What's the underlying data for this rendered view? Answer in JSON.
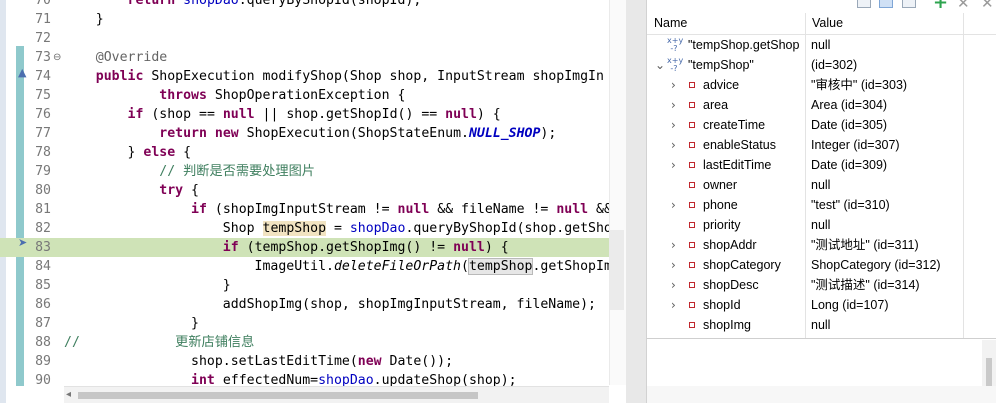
{
  "editor": {
    "lines": [
      {
        "num": "70",
        "html": "        <span class=\"kw\">return</span> <span class=\"fld\">shopDao</span>.queryByShopId(shopId);",
        "hl": false
      },
      {
        "num": "71",
        "html": "    }",
        "hl": false
      },
      {
        "num": "72",
        "html": "",
        "hl": false
      },
      {
        "num": "73",
        "html": "    <span class=\"ann\">@Override</span>",
        "hl": false,
        "fold": "⊖"
      },
      {
        "num": "74",
        "html": "    <span class=\"kw\">public</span> ShopExecution modifyShop(Shop shop, InputStream shopImgIn",
        "hl": false
      },
      {
        "num": "75",
        "html": "            <span class=\"kw\">throws</span> ShopOperationException {",
        "hl": false
      },
      {
        "num": "76",
        "html": "        <span class=\"kw\">if</span> (shop == <span class=\"kw\">null</span> || shop.getShopId() == <span class=\"kw\">null</span>) {",
        "hl": false
      },
      {
        "num": "77",
        "html": "            <span class=\"kw\">return</span> <span class=\"kw\">new</span> ShopExecution(ShopStateEnum.<span class=\"const\">NULL_SHOP</span>);",
        "hl": false
      },
      {
        "num": "78",
        "html": "        } <span class=\"kw\">else</span> {",
        "hl": false
      },
      {
        "num": "79",
        "html": "            <span class=\"cm\">// 判断是否需要处理图片</span>",
        "hl": false
      },
      {
        "num": "80",
        "html": "            <span class=\"kw\">try</span> {",
        "hl": false
      },
      {
        "num": "81",
        "html": "                <span class=\"kw\">if</span> (shopImgInputStream != <span class=\"kw\">null</span> &amp;&amp; fileName != <span class=\"kw\">null</span> &amp;&amp; !\"",
        "hl": false
      },
      {
        "num": "82",
        "html": "                    Shop <span class=\"occ\">tempShop</span> = <span class=\"fld\">shopDao</span>.queryByShopId(shop.getShopId",
        "hl": false
      },
      {
        "num": "83",
        "html": "                    <span class=\"kw\">if</span> (tempShop.getShopImg() != <span class=\"kw\">null</span>) {",
        "hl": true
      },
      {
        "num": "84",
        "html": "                        ImageUtil.<span class=\"sm\">deleteFileOrPath</span>(<span class=\"occ2\">tempShop</span>.getShopImg()",
        "hl": false
      },
      {
        "num": "85",
        "html": "                    }",
        "hl": false
      },
      {
        "num": "86",
        "html": "                    addShopImg(shop, shopImgInputStream, fileName);",
        "hl": false
      },
      {
        "num": "87",
        "html": "                }",
        "hl": false
      },
      {
        "num": "88",
        "html": "<span class=\"cm\">//            更新店铺信息</span>",
        "hl": false
      },
      {
        "num": "89",
        "html": "                shop.setLastEditTime(<span class=\"kw\">new</span> Date());",
        "hl": false
      },
      {
        "num": "90",
        "html": "                <span class=\"kw\">int</span> effectedNum=<span class=\"fld\">shopDao</span>.updateShop(shop);",
        "hl": false
      }
    ]
  },
  "variables": {
    "header": {
      "name": "Name",
      "value": "Value"
    },
    "rows": [
      {
        "level": 0,
        "expander": "",
        "icon": "expr",
        "name": "\"tempShop.getShop",
        "value": "null"
      },
      {
        "level": 0,
        "expander": "⌄",
        "icon": "expr",
        "name": "\"tempShop\"",
        "value": " (id=302)"
      },
      {
        "level": 1,
        "expander": "›",
        "icon": "field",
        "name": "advice",
        "value": "\"审核中\" (id=303)"
      },
      {
        "level": 1,
        "expander": "›",
        "icon": "field",
        "name": "area",
        "value": "Area  (id=304)"
      },
      {
        "level": 1,
        "expander": "›",
        "icon": "field",
        "name": "createTime",
        "value": "Date  (id=305)"
      },
      {
        "level": 1,
        "expander": "›",
        "icon": "field",
        "name": "enableStatus",
        "value": "Integer  (id=307)"
      },
      {
        "level": 1,
        "expander": "›",
        "icon": "field",
        "name": "lastEditTime",
        "value": "Date  (id=309)"
      },
      {
        "level": 1,
        "expander": "",
        "icon": "field",
        "name": "owner",
        "value": "null"
      },
      {
        "level": 1,
        "expander": "›",
        "icon": "field",
        "name": "phone",
        "value": "\"test\" (id=310)"
      },
      {
        "level": 1,
        "expander": "",
        "icon": "field",
        "name": "priority",
        "value": "null"
      },
      {
        "level": 1,
        "expander": "›",
        "icon": "field",
        "name": "shopAddr",
        "value": "\"测试地址\" (id=311)"
      },
      {
        "level": 1,
        "expander": "›",
        "icon": "field",
        "name": "shopCategory",
        "value": "ShopCategory  (id=312)"
      },
      {
        "level": 1,
        "expander": "›",
        "icon": "field",
        "name": "shopDesc",
        "value": "\"测试描述\" (id=314)"
      },
      {
        "level": 1,
        "expander": "›",
        "icon": "field",
        "name": "shopId",
        "value": "Long  (id=107)"
      },
      {
        "level": 1,
        "expander": "",
        "icon": "field",
        "name": "shopImg",
        "value": "null"
      }
    ]
  },
  "icons": {
    "expression": "x+y-expression-icon",
    "field": "private-field-icon",
    "expand": "chevron-right-icon",
    "collapse": "chevron-down-icon",
    "add": "plus-icon",
    "remove": "close-icon"
  },
  "colors": {
    "keyword": "#7f0055",
    "comment": "#3f7f5f",
    "field": "#0000c0",
    "current_line": "#cfe3b7",
    "occurrence": "#f1e3c1"
  }
}
